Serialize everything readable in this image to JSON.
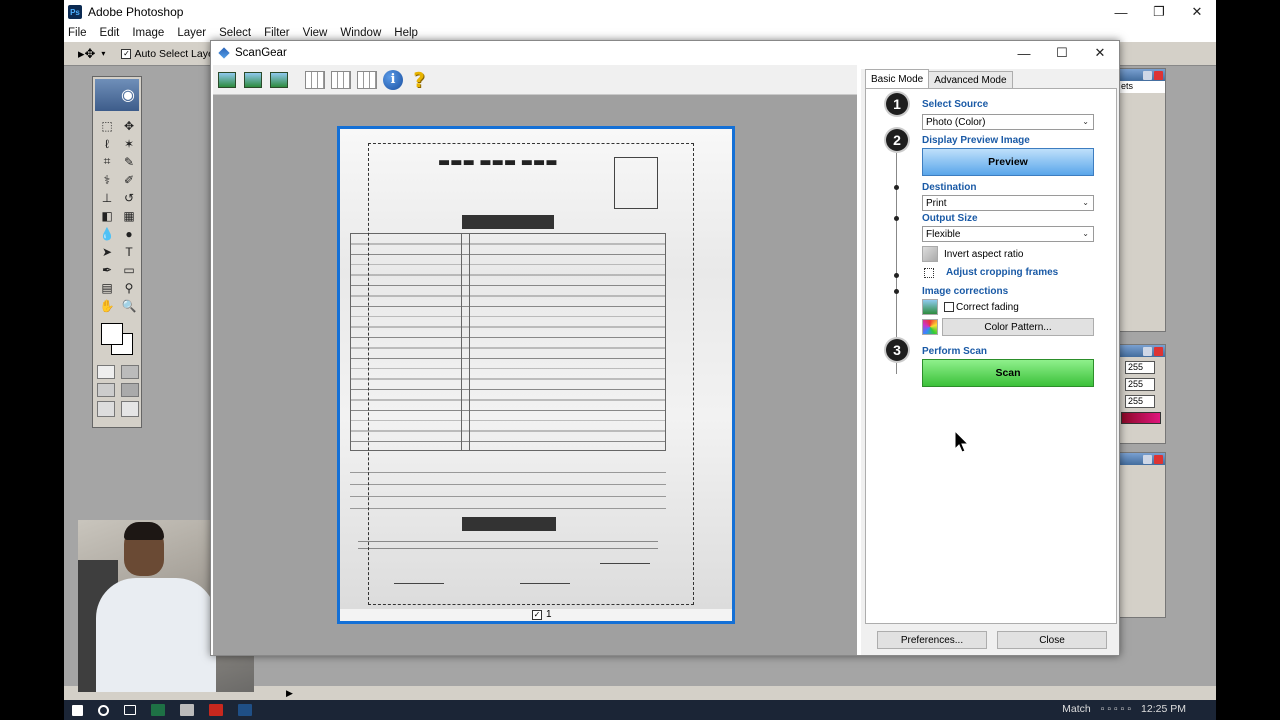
{
  "photoshop": {
    "title": "Adobe Photoshop",
    "menu": [
      "File",
      "Edit",
      "Image",
      "Layer",
      "Select",
      "Filter",
      "View",
      "Window",
      "Help"
    ],
    "auto_select_label": "Auto Select Layer"
  },
  "window_controls": {
    "minimize": "—",
    "maximize": "☐",
    "restore": "❐",
    "close": "✕"
  },
  "scangear": {
    "title": "ScanGear",
    "tabs": [
      "Basic Mode",
      "Advanced Mode"
    ],
    "steps": {
      "one": "1",
      "two": "2",
      "three": "3"
    },
    "select_source_label": "Select Source",
    "select_source_value": "Photo (Color)",
    "display_preview_label": "Display Preview Image",
    "preview_button": "Preview",
    "destination_label": "Destination",
    "destination_value": "Print",
    "output_size_label": "Output Size",
    "output_size_value": "Flexible",
    "invert_aspect_label": "Invert aspect ratio",
    "adjust_cropping_label": "Adjust cropping frames",
    "image_corrections_label": "Image corrections",
    "correct_fading_label": "Correct fading",
    "color_pattern_button": "Color Pattern...",
    "perform_scan_label": "Perform Scan",
    "scan_button": "Scan",
    "preferences_button": "Preferences...",
    "close_button": "Close",
    "frame_number": "1"
  },
  "side_panels": {
    "values": [
      "255",
      "255",
      "255"
    ],
    "tab_fragment": "ets"
  },
  "taskbar": {
    "search_text": "Match",
    "clock": "12:25 PM"
  },
  "icons": [
    "photoshop-logo-icon",
    "move-tool-icon",
    "scangear-logo-icon",
    "info-icon",
    "help-icon",
    "dropdown-caret-icon",
    "invert-aspect-icon",
    "correct-fading-icon",
    "color-pattern-icon",
    "windows-start-icon"
  ],
  "colors": {
    "preview_button": "#5aa6ea",
    "scan_button": "#3cc13a",
    "section_label": "#1a5aa6",
    "crop_frame": "#1470d6"
  }
}
